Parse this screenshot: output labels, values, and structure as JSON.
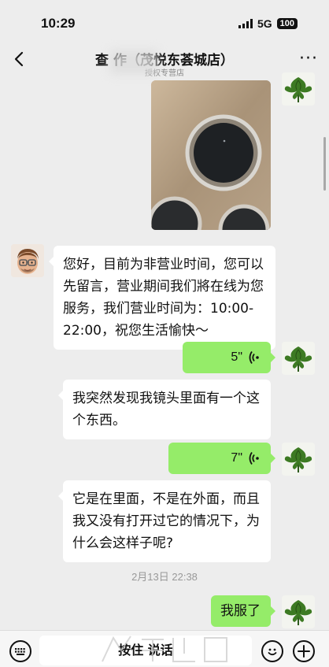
{
  "status_bar": {
    "time": "10:29",
    "network": "5G",
    "battery": "100"
  },
  "header": {
    "title": "查 作（茂悦东荟城店）",
    "subtitle": "授权专营店"
  },
  "messages": [
    {
      "side": "right",
      "type": "image",
      "alt": "photo of camera lens"
    },
    {
      "side": "left",
      "type": "text",
      "lines": [
        "您好，目前为非营业时间，您可以",
        "先留言，营业期间我们將在线为您",
        "服务，我们营业时间为：10:00-",
        "22:00，祝您生活愉快～"
      ]
    },
    {
      "side": "right",
      "type": "voice",
      "duration": "5\""
    },
    {
      "side": "left",
      "type": "text",
      "lines": [
        "我突然发现我镜头里面有一个这",
        "个东西。"
      ]
    },
    {
      "side": "right",
      "type": "voice",
      "duration": "7\""
    },
    {
      "side": "left",
      "type": "text",
      "lines": [
        "它是在里面，不是在外面，而且",
        "我又没有打开过它的情况下，为",
        "什么会这样子呢?"
      ]
    },
    {
      "side": "right",
      "type": "text",
      "text": "我服了"
    }
  ],
  "timestamp": "2月13日 22:38",
  "input_bar": {
    "hold_to_talk": "按住 说话"
  },
  "colors": {
    "background": "#ededed",
    "self_bubble": "#95ec69",
    "other_bubble": "#ffffff"
  },
  "icons": [
    "back-arrow-icon",
    "more-icon",
    "voice-wave-icon",
    "keyboard-icon",
    "emoji-icon",
    "plus-icon"
  ]
}
